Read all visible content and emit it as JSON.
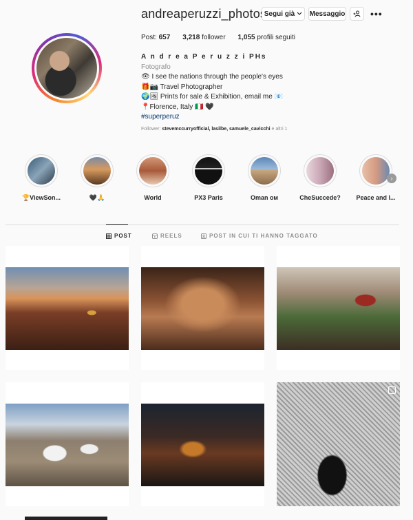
{
  "profile": {
    "username": "andreaperuzzi_photos",
    "follow_label": "Segui già",
    "message_label": "Messaggio",
    "add_user_symbol": "+⁄",
    "more_symbol": "•••"
  },
  "stats": {
    "posts_label": "Post:",
    "posts_value": "657",
    "followers_value": "3,218",
    "followers_label": "follower",
    "following_value": "1,055",
    "following_label": "profili seguiti"
  },
  "bio": {
    "name": "A n d r e a P e r u z z i PHs",
    "category": "Fotografo",
    "line1": "👁 I see the nations through the people's eyes",
    "line2": "🎁📷 Travel Photographer",
    "line3": "🌍🖼 Prints for sale & Exhibition, email me 📧",
    "line4": "📍Florence, Italy 🇮🇹 🖤",
    "hashtag": "#superperuz",
    "followed_by_label": "Follower:",
    "followed_by_users": "stevemccurryofficial, lasilbe, samuele_cavicchi",
    "followed_by_more": "e altri 1"
  },
  "highlights": [
    {
      "label": "🏆ViewSon...",
      "color": "#3a5a78"
    },
    {
      "label": "🖤🙏",
      "color": "#b06a3d"
    },
    {
      "label": "World",
      "color": "#c87b55"
    },
    {
      "label": "PX3 Paris",
      "color": "#1e1e1e"
    },
    {
      "label": "Oman ом",
      "color": "#5d86b7"
    },
    {
      "label": "CheSuccede?",
      "color": "#caa7b5"
    },
    {
      "label": "Peace and l...",
      "color": "#d69a82"
    }
  ],
  "tabs": {
    "posts": "POST",
    "reels": "REELS",
    "tagged": "POST IN CUI TI HANNO TAGGATO"
  },
  "colors": {
    "text": "#262626",
    "secondary": "#8e8e8e",
    "link": "#00376b",
    "border": "#dbdbdb"
  }
}
